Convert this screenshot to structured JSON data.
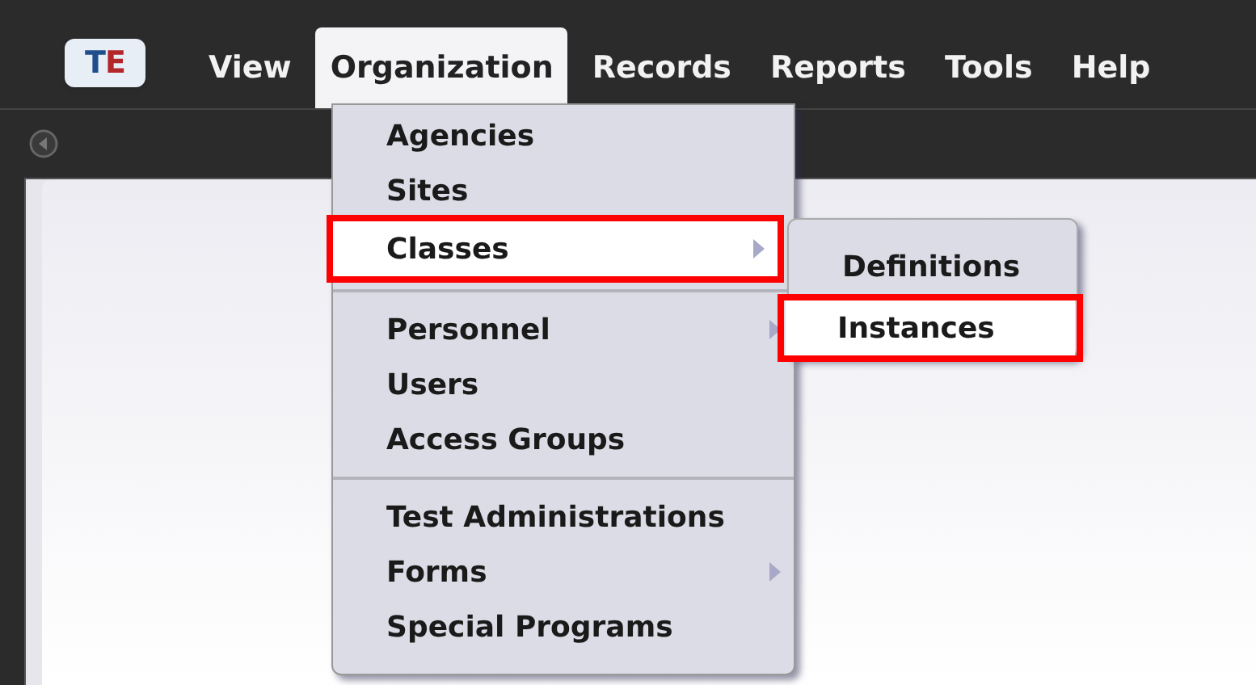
{
  "logo": {
    "text": "TE"
  },
  "menu_bar": [
    {
      "label": "View",
      "selected": false
    },
    {
      "label": "Organization",
      "selected": true
    },
    {
      "label": "Records",
      "selected": false
    },
    {
      "label": "Reports",
      "selected": false
    },
    {
      "label": "Tools",
      "selected": false
    },
    {
      "label": "Help",
      "selected": false
    }
  ],
  "dropdown": {
    "groups": [
      [
        {
          "label": "Agencies",
          "selected": false,
          "annotated": false,
          "has_submenu": false
        },
        {
          "label": "Sites",
          "selected": false,
          "annotated": false,
          "has_submenu": false
        },
        {
          "label": "Classes",
          "selected": true,
          "annotated": true,
          "has_submenu": true
        }
      ],
      [
        {
          "label": "Personnel",
          "selected": false,
          "annotated": false,
          "has_submenu": true
        },
        {
          "label": "Users",
          "selected": false,
          "annotated": false,
          "has_submenu": false
        },
        {
          "label": "Access Groups",
          "selected": false,
          "annotated": false,
          "has_submenu": false
        }
      ],
      [
        {
          "label": "Test Administrations",
          "selected": false,
          "annotated": false,
          "has_submenu": false
        },
        {
          "label": "Forms",
          "selected": false,
          "annotated": false,
          "has_submenu": true
        },
        {
          "label": "Special Programs",
          "selected": false,
          "annotated": false,
          "has_submenu": false
        }
      ]
    ]
  },
  "submenu": {
    "items": [
      {
        "label": "Definitions",
        "selected": false,
        "annotated": false
      },
      {
        "label": "Instances",
        "selected": true,
        "annotated": true
      }
    ]
  }
}
